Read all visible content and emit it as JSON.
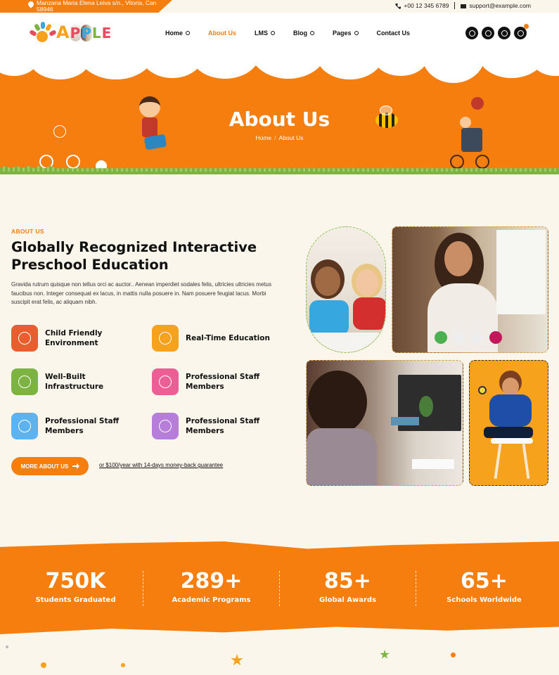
{
  "topbar": {
    "address": "Manzana Maria Elena Leiva s/n., Vitoria, Can 58946",
    "phone": "+00 12 345 6789",
    "email": "support@example.com"
  },
  "logo": {
    "letters": [
      "A",
      "P",
      "P",
      "L",
      "E"
    ]
  },
  "nav": [
    {
      "label": "Home",
      "active": false
    },
    {
      "label": "About Us",
      "active": true
    },
    {
      "label": "LMS",
      "active": false
    },
    {
      "label": "Blog",
      "active": false
    },
    {
      "label": "Pages",
      "active": false
    },
    {
      "label": "Contact Us",
      "active": false
    }
  ],
  "hero": {
    "title": "About Us",
    "breadcrumb": {
      "home": "Home",
      "separator": "/",
      "current": "About Us"
    }
  },
  "about": {
    "label": "ABOUT US",
    "title": "Globally Recognized Interactive Preschool Education",
    "description": "Gravida rutrum quisque non tellus orci ac auctor.. Aenean imperdiet sodales felis, ultricies ultricies metus faucibus non. Integer consequat ex lacus, in mattis nulla posuere in. Nam posuere feugiat lacus. Morbi suscipit erat felis, ac aliquam nibh.",
    "features": [
      {
        "label": "Child Friendly Environment",
        "icon": "child-brain-icon",
        "color": "#e85e2e"
      },
      {
        "label": "Real-Time Education",
        "icon": "graduate-icon",
        "color": "#f7a21c"
      },
      {
        "label": "Well-Built Infrastructure",
        "icon": "globe-cap-icon",
        "color": "#7cb342"
      },
      {
        "label": "Professional Staff Members",
        "icon": "mobile-cap-icon",
        "color": "#ec5f95"
      },
      {
        "label": "Professional Staff Members",
        "icon": "mobile-cap-icon",
        "color": "#5cb3f0"
      },
      {
        "label": "Professional Staff Members",
        "icon": "mobile-cap-icon",
        "color": "#b77ddb"
      }
    ],
    "button_label": "MORE ABOUT US",
    "guarantee": "or $100/year with 14-days money-back guarantee"
  },
  "stats": [
    {
      "value": "750K",
      "label": "Students Graduated"
    },
    {
      "value": "289+",
      "label": "Academic Programs"
    },
    {
      "value": "85+",
      "label": "Global Awards"
    },
    {
      "value": "65+",
      "label": "Schools Worldwide"
    }
  ],
  "colors": {
    "accent": "#f57e0f",
    "cream": "#fbf6ec"
  }
}
